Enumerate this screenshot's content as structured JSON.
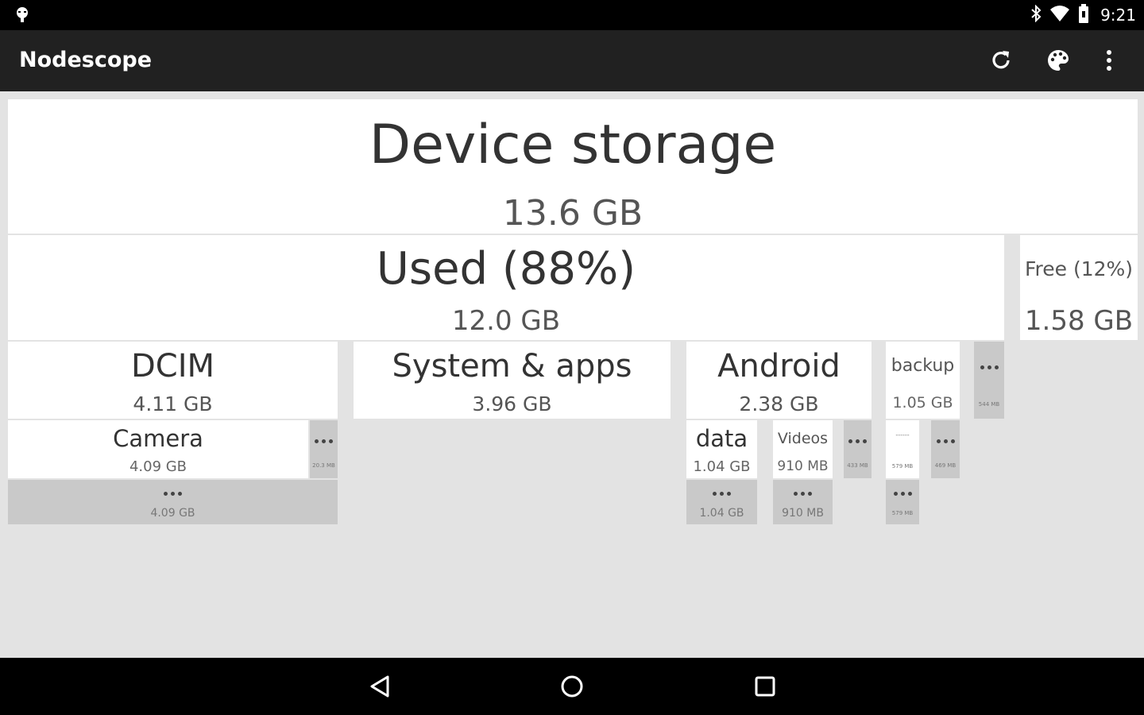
{
  "status_bar": {
    "time": "9:21",
    "icons": [
      "notification-icon",
      "bluetooth-icon",
      "wifi-icon",
      "battery-icon"
    ]
  },
  "app_bar": {
    "title": "Nodescope",
    "actions": [
      "refresh-icon",
      "palette-icon",
      "overflow-menu-icon"
    ]
  },
  "treemap": {
    "device": {
      "name": "Device storage",
      "size": "13.6 GB"
    },
    "used": {
      "name": "Used (88%)",
      "size": "12.0 GB"
    },
    "free": {
      "name": "Free (12%)",
      "size": "1.58 GB"
    },
    "dcim": {
      "name": "DCIM",
      "size": "4.11 GB"
    },
    "camera": {
      "name": "Camera",
      "size": "4.09 GB"
    },
    "camera_more": {
      "size": "4.09 GB"
    },
    "dcim_more": {
      "size": "20.3 MB"
    },
    "system": {
      "name": "System & apps",
      "size": "3.96 GB"
    },
    "android": {
      "name": "Android",
      "size": "2.38 GB"
    },
    "data": {
      "name": "data",
      "size": "1.04 GB"
    },
    "data_more": {
      "size": "1.04 GB"
    },
    "videos": {
      "name": "Videos",
      "size": "910 MB"
    },
    "videos_more": {
      "size": "910 MB"
    },
    "android_more": {
      "size": "433 MB"
    },
    "backup": {
      "name": "backup",
      "size": "1.05 GB"
    },
    "backup_child": {
      "name": "------",
      "size": "579 MB"
    },
    "backup_child_more": {
      "size": "579 MB"
    },
    "backup_more": {
      "size": "469 MB"
    },
    "used_more": {
      "size": "544 MB"
    }
  }
}
